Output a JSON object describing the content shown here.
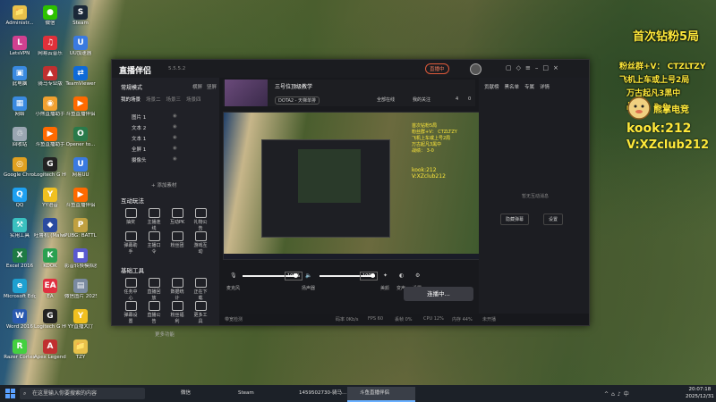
{
  "desktop": {
    "icons": [
      {
        "label": "Administr...",
        "name": "admin-folder-icon",
        "color": "#e8c14a",
        "glyph": "📁"
      },
      {
        "label": "微信",
        "name": "wechat-icon",
        "color": "#2dc100",
        "glyph": "●"
      },
      {
        "label": "Steam",
        "name": "steam-icon",
        "color": "#1b2838",
        "glyph": "S"
      },
      {
        "label": "LetsVPN",
        "name": "letsvpn-icon",
        "color": "#d04090",
        "glyph": "L"
      },
      {
        "label": "网易云音乐",
        "name": "netease-music-icon",
        "color": "#e0303a",
        "glyph": "♫"
      },
      {
        "label": "UU加速器",
        "name": "uu-accelerator-icon",
        "color": "#3a7ae0",
        "glyph": "U"
      },
      {
        "label": "此电脑",
        "name": "this-pc-icon",
        "color": "#3a8ae0",
        "glyph": "▣"
      },
      {
        "label": "骑马专业版",
        "name": "qima-icon",
        "color": "#c03030",
        "glyph": "▲"
      },
      {
        "label": "TeamViewer",
        "name": "teamviewer-icon",
        "color": "#0e6ad8",
        "glyph": "⇄"
      },
      {
        "label": "网络",
        "name": "network-icon",
        "color": "#3a8ae0",
        "glyph": "▦"
      },
      {
        "label": "小熊直播助手",
        "name": "bear-live-icon",
        "color": "#f0a030",
        "glyph": "◉"
      },
      {
        "label": "斗鱼直播伴侣",
        "name": "douyu-companion-icon",
        "color": "#ff6a00",
        "glyph": "▶"
      },
      {
        "label": "回收站",
        "name": "recycle-bin-icon",
        "color": "#9aa6b2",
        "glyph": "♲"
      },
      {
        "label": "斗鱼直播助手",
        "name": "douyu-helper-icon",
        "color": "#ff6a00",
        "glyph": "▶"
      },
      {
        "label": "Opener to...",
        "name": "opener-icon",
        "color": "#2a7a4a",
        "glyph": "O"
      },
      {
        "label": "Google Chrome",
        "name": "chrome-icon",
        "color": "#e0a020",
        "glyph": "◎"
      },
      {
        "label": "Logitech G HUB",
        "name": "logitech-ghub-icon",
        "color": "#222222",
        "glyph": "G"
      },
      {
        "label": "网易UU",
        "name": "netease-uu-icon",
        "color": "#3a7ae0",
        "glyph": "U"
      },
      {
        "label": "QQ",
        "name": "qq-icon",
        "color": "#1ea0f0",
        "glyph": "Q"
      },
      {
        "label": "YY语音",
        "name": "yy-voice-icon",
        "color": "#f0c020",
        "glyph": "Y"
      },
      {
        "label": "斗鱼直播伴侣",
        "name": "douyu-icon-2",
        "color": "#ff6a00",
        "glyph": "▶"
      },
      {
        "label": "实用工具",
        "name": "tools-icon",
        "color": "#3ac0c0",
        "glyph": "⚒"
      },
      {
        "label": "吐鲁机 (Malware)",
        "name": "security-icon",
        "color": "#2a4aa0",
        "glyph": "◆"
      },
      {
        "label": "PUBG: BATTLEGR...",
        "name": "pubg-icon",
        "color": "#c0a040",
        "glyph": "P"
      },
      {
        "label": "Excel 2016",
        "name": "excel-icon",
        "color": "#1e7a44",
        "glyph": "X"
      },
      {
        "label": "KOOK",
        "name": "kook-icon",
        "color": "#2aa050",
        "glyph": "K"
      },
      {
        "label": "影音转换模拟器",
        "name": "emulator-icon",
        "color": "#5a5ad0",
        "glyph": "■"
      },
      {
        "label": "Microsoft Edge",
        "name": "edge-icon",
        "color": "#1ea0d0",
        "glyph": "e"
      },
      {
        "label": "EA",
        "name": "ea-icon",
        "color": "#e03040",
        "glyph": "EA"
      },
      {
        "label": "微信图片 2025080...",
        "name": "wechat-image-icon",
        "color": "#7a8aa0",
        "glyph": "▤"
      },
      {
        "label": "Word 2016",
        "name": "word-icon",
        "color": "#2a5ab0",
        "glyph": "W"
      },
      {
        "label": "Logitech G HUB",
        "name": "logitech-ghub-icon-2",
        "color": "#222222",
        "glyph": "G"
      },
      {
        "label": "YY直播大厅",
        "name": "yy-live-icon",
        "color": "#f0c020",
        "glyph": "Y"
      },
      {
        "label": "Razer Cortex",
        "name": "razer-cortex-icon",
        "color": "#44d040",
        "glyph": "R"
      },
      {
        "label": "Apex Legends",
        "name": "apex-icon",
        "color": "#c03030",
        "glyph": "A"
      },
      {
        "label": "TZY",
        "name": "tzy-folder-icon",
        "color": "#e8c14a",
        "glyph": "📁"
      }
    ]
  },
  "promo": {
    "title": "首次钻粉5局",
    "line1": "粉丝群+V： CTZLTZY",
    "line2": "飞机上车或上号2局",
    "line3": "万古起凡3黑中",
    "line4": "战绩： 3-0",
    "logo_text": "熊掌电竞",
    "kook": "kook:212",
    "vx": "V:XZclub212"
  },
  "app": {
    "brand": "直播伴侣",
    "version": "5.5.5.2",
    "live_badge": "直播中",
    "left": {
      "mode": "常规模式",
      "landscape": "横屏",
      "portrait": "竖屏",
      "tabs": [
        "我的场景",
        "场景二",
        "场景三",
        "场景四"
      ],
      "sources": [
        "图片 1",
        "文本 2",
        "文本 1",
        "全屏 1",
        "摄像头"
      ],
      "add_source": "+ 添加素材",
      "interactive_title": "互动玩法",
      "interactive": [
        "抽奖",
        "主播连线",
        "互动PK",
        "礼物公告",
        "弹幕助手",
        "主播口令",
        "粉丝团",
        "游戏互动"
      ],
      "tools_title": "基础工具",
      "tools": [
        "任务中心",
        "直播回放",
        "数据统计",
        "正在下载",
        "弹幕设置",
        "直播公告",
        "粉丝福利",
        "更多工具"
      ],
      "more": "更多功能"
    },
    "room": {
      "title": "三号位顶级教学",
      "category": "DOTA2 - 天梯单排",
      "stat1": "全部在线",
      "stat2": "我的关注",
      "stat3": "4",
      "stat4": "0"
    },
    "mixer": {
      "mic_label": "麦克风",
      "mic_pct": "100%",
      "speaker_label": "扬声器",
      "speaker_pct": "100%",
      "mic_level": 1.0,
      "speaker_level": 1.0,
      "btn_beauty": "美颜",
      "btn_voice": "变声",
      "btn_settings": "设置"
    },
    "golive": "连播中...",
    "status": {
      "a": "带宽检测",
      "b": "码率 0Kb/s",
      "c": "FPS 60",
      "d": "丢帧 0%",
      "e": "CPU 12%",
      "f": "内存 44%",
      "g": "未开播"
    },
    "right": {
      "tabs": [
        "贡献榜",
        "黑名单",
        "专属",
        "详情"
      ],
      "empty": "暂无互动消息",
      "btn1": "隐藏弹幕",
      "btn2": "设置"
    }
  },
  "taskbar": {
    "search": "在这里输入你要搜索的内容",
    "tasks": [
      "微信",
      "Steam",
      "1459502730-骑马...",
      "斗鱼直播伴侣"
    ],
    "time": "20:07:18",
    "date": "2025/12/31"
  }
}
